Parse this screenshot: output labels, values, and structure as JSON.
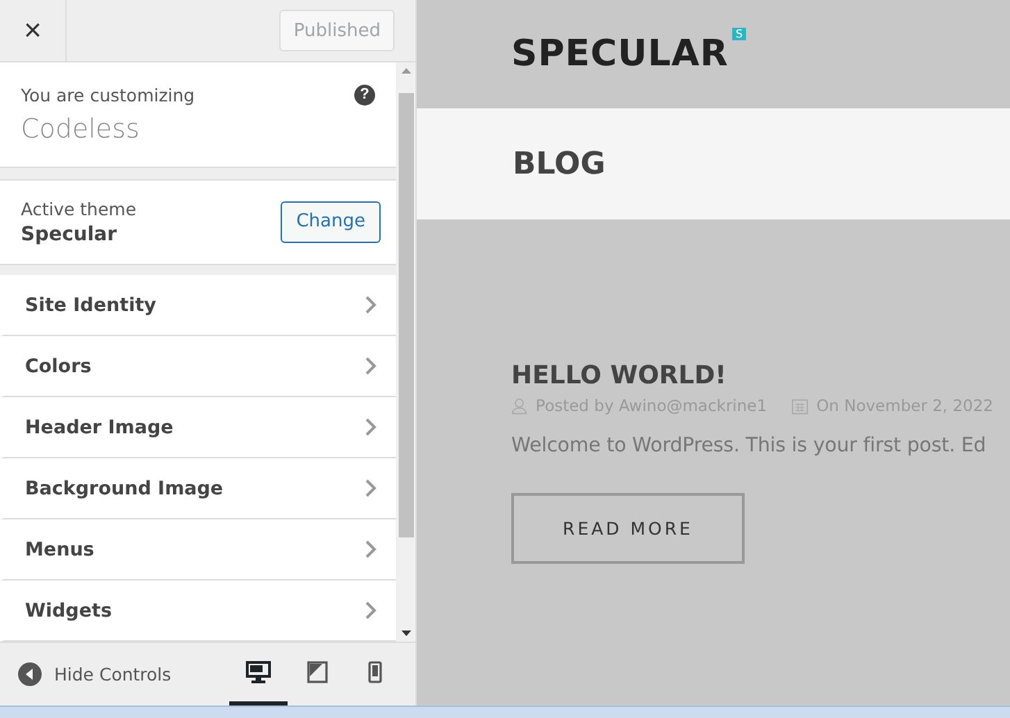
{
  "header": {
    "close": "×",
    "publish_button": {
      "label": "Published",
      "disabled": true
    }
  },
  "customizing": {
    "label": "You are customizing",
    "site": "Codeless",
    "help": "?"
  },
  "theme": {
    "label": "Active theme",
    "name": "Specular",
    "button": "Change"
  },
  "sections": [
    {
      "label": "Site Identity"
    },
    {
      "label": "Colors"
    },
    {
      "label": "Header Image"
    },
    {
      "label": "Background Image"
    },
    {
      "label": "Menus"
    },
    {
      "label": "Widgets"
    }
  ],
  "footer": {
    "hide_controls": "Hide Controls",
    "devices": [
      {
        "kind": "desktop",
        "selected": true
      },
      {
        "kind": "tablet",
        "selected": false
      },
      {
        "kind": "mobile",
        "selected": false
      }
    ]
  },
  "preview": {
    "logo": "SPECULAR",
    "logo_badge": "S",
    "page_title": "BLOG",
    "post": {
      "title": "HELLO WORLD!",
      "author": "Posted by Awino@mackrine1",
      "date": "On November 2, 2022",
      "excerpt": "Welcome to WordPress. This is your first post. Ed",
      "button": "READ MORE"
    }
  }
}
